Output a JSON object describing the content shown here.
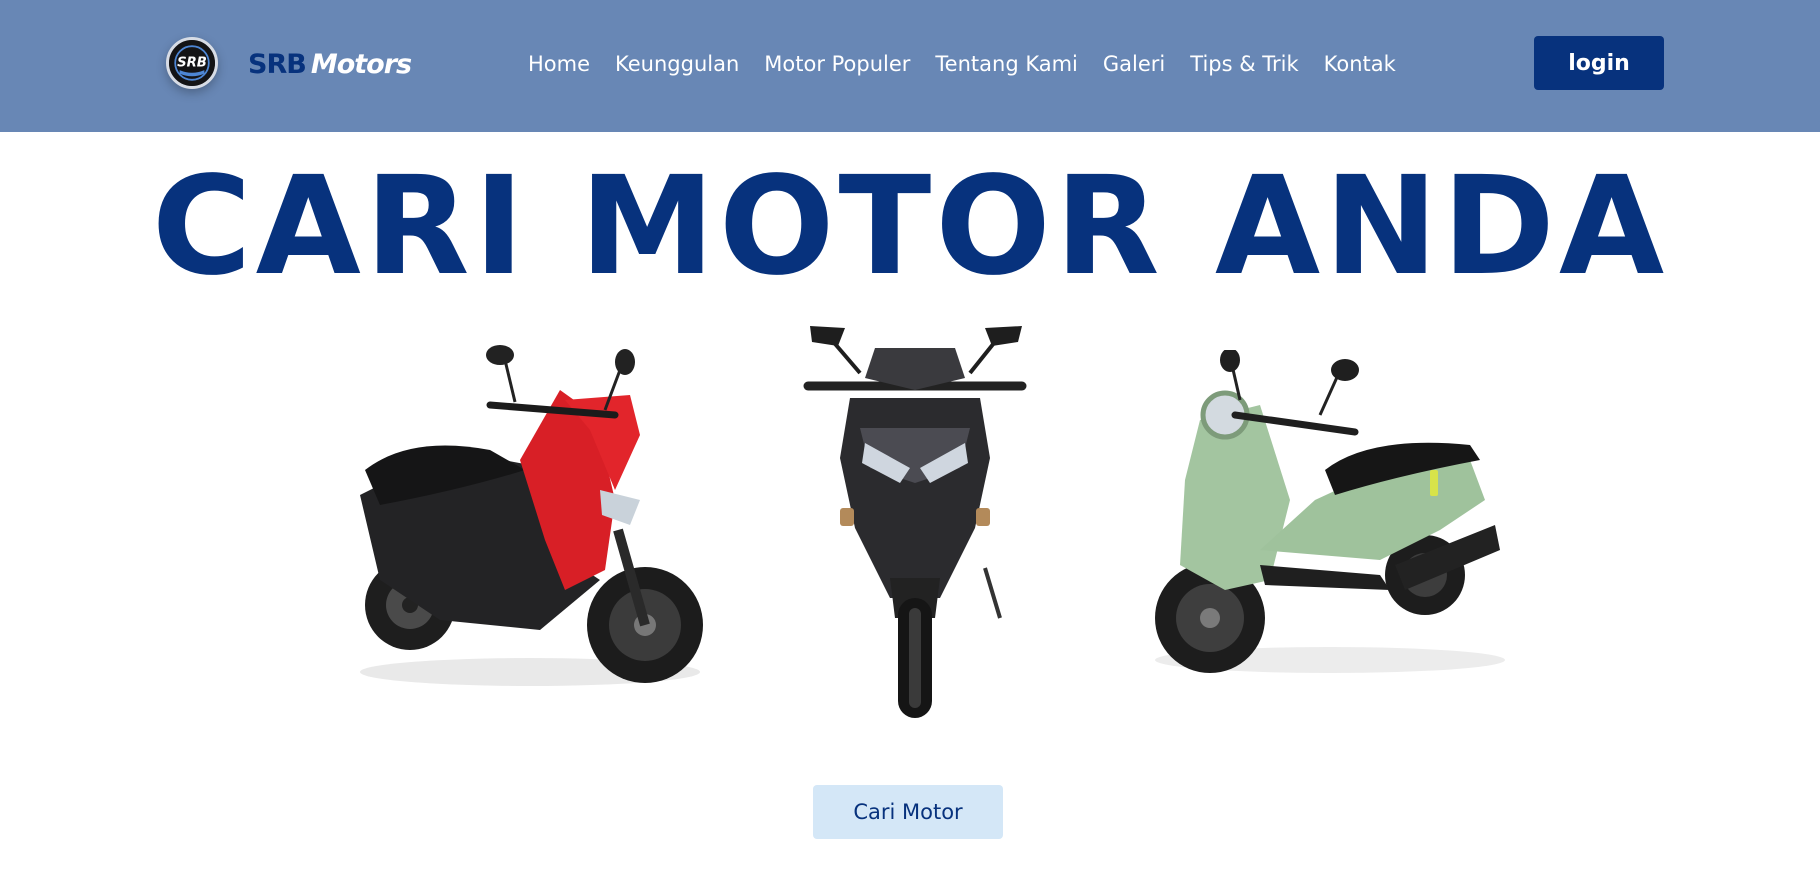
{
  "header": {
    "logo": {
      "icon": "srb-logo-badge",
      "badge_text": "SRB",
      "badge_subtext": "MOTORS"
    },
    "brand": {
      "part1": "SRB",
      "part2": "Motors"
    },
    "nav": [
      {
        "label": "Home"
      },
      {
        "label": "Keunggulan"
      },
      {
        "label": "Motor Populer"
      },
      {
        "label": "Tentang Kami"
      },
      {
        "label": "Galeri"
      },
      {
        "label": "Tips & Trik"
      },
      {
        "label": "Kontak"
      }
    ],
    "login_label": "login"
  },
  "hero": {
    "title": "CARI MOTOR ANDA",
    "motorcycles": [
      {
        "name": "red-scooter-image",
        "color": "#d81f26"
      },
      {
        "name": "black-scooter-image",
        "color": "#2b2b2e"
      },
      {
        "name": "green-scooter-image",
        "color": "#a3c5a0"
      }
    ],
    "cta_label": "Cari Motor"
  },
  "colors": {
    "header_bg": "#6887b5",
    "primary": "#07327d",
    "cta_bg": "#d4e7f7",
    "page_bg": "#ffffff"
  }
}
